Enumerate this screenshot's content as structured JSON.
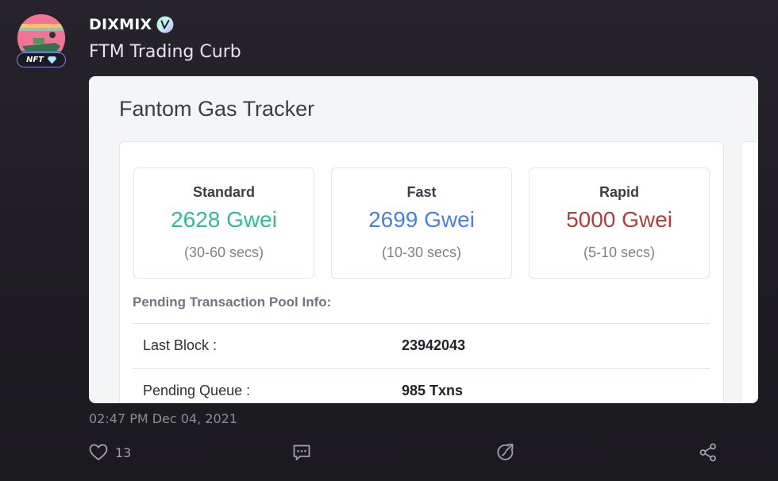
{
  "post": {
    "username": "DIXMIX",
    "badge": "NFT",
    "text": "FTM Trading Curb",
    "timestamp": "02:47 PM Dec 04, 2021"
  },
  "gas_tracker": {
    "title": "Fantom Gas Tracker",
    "tiers": [
      {
        "label": "Standard",
        "value": "2628 Gwei",
        "time": "(30-60 secs)",
        "color": "#2ebd97"
      },
      {
        "label": "Fast",
        "value": "2699 Gwei",
        "time": "(10-30 secs)",
        "color": "#4a7fe8"
      },
      {
        "label": "Rapid",
        "value": "5000 Gwei",
        "time": "(5-10 secs)",
        "color": "#b03e3e"
      }
    ],
    "pool_title": "Pending Transaction Pool Info:",
    "rows": [
      {
        "key": "Last Block :",
        "value": "23942043"
      },
      {
        "key": "Pending Queue :",
        "value": "985 Txns"
      }
    ]
  },
  "actions": {
    "like_count": "13"
  },
  "icons": [
    "heart-icon",
    "comment-icon",
    "repost-icon",
    "share-icon",
    "verified-icon",
    "diamond-icon"
  ]
}
